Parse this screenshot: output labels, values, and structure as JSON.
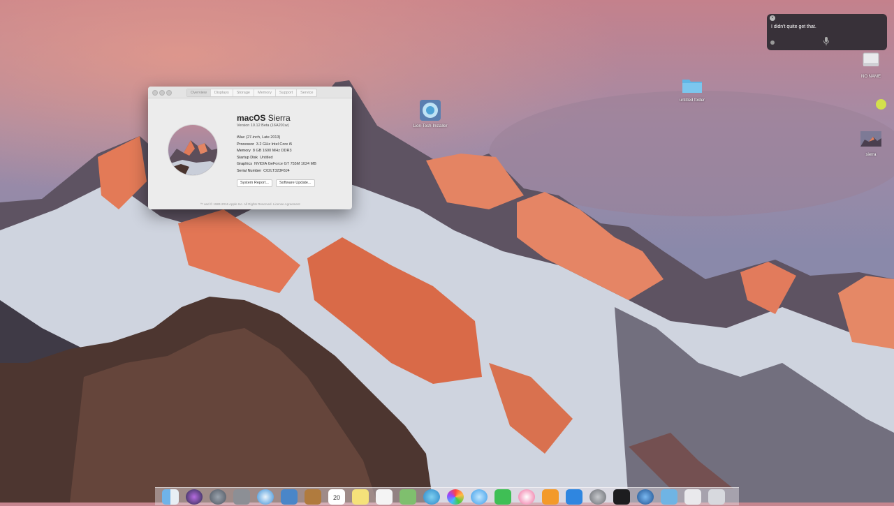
{
  "siri": {
    "message": "I didn't quite get that.",
    "close_glyph": "×"
  },
  "desktop": {
    "drive_label": "NO NAME",
    "folder_label": "untitled folder",
    "installer_label": "Lion-Tech-Installer",
    "sierra_label": "sierra"
  },
  "about": {
    "tabs": [
      "Overview",
      "Displays",
      "Storage",
      "Memory",
      "Support",
      "Service"
    ],
    "os_name_bold": "macOS",
    "os_name_rest": " Sierra",
    "version": "Version 10.12 Beta (16A201w)",
    "model": "iMac (27-inch, Late 2013)",
    "specs": [
      {
        "key": "Processor",
        "value": "3.2 GHz Intel Core i5"
      },
      {
        "key": "Memory",
        "value": "8 GB 1600 MHz DDR3"
      },
      {
        "key": "Startup Disk",
        "value": "Untitled"
      },
      {
        "key": "Graphics",
        "value": "NVIDIA GeForce GT 755M 1024 MB"
      },
      {
        "key": "Serial Number",
        "value": "C02LT323F8J4"
      }
    ],
    "system_report_label": "System Report...",
    "software_update_label": "Software Update...",
    "footer": "™ and © 1983-2016 Apple Inc. All Rights Reserved. License Agreement"
  },
  "dock": {
    "items": [
      "finder-icon",
      "siri-icon",
      "launchpad-icon",
      "photo-tool-icon",
      "safari-icon",
      "mail-icon",
      "notes-book-icon",
      "calendar-icon",
      "notes-icon",
      "reminders-icon",
      "maps-icon",
      "app-store-blue-icon",
      "photos-icon",
      "messages-icon",
      "facetime-icon",
      "itunes-icon",
      "ibooks-icon",
      "app-store-icon",
      "system-preferences-icon",
      "terminal-icon",
      "quicktime-icon",
      "downloads-folder-icon",
      "documents-stack-icon",
      "trash-icon"
    ],
    "calendar_day": "20"
  },
  "colors": {
    "siri_bg": "#26262c",
    "green_indicator": "#d3e04c",
    "folder_blue": "#5fb6e6"
  }
}
